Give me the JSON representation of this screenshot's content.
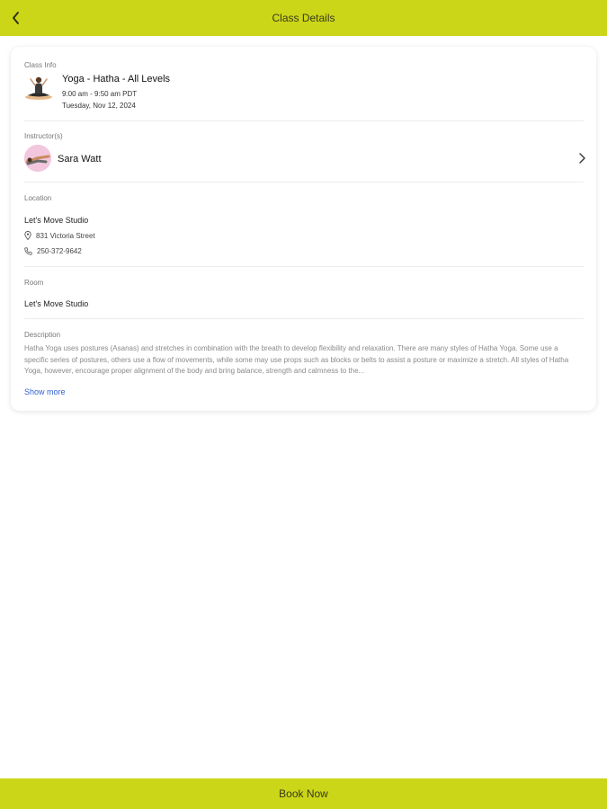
{
  "header": {
    "title": "Class Details",
    "back_icon": "chevron-left-icon"
  },
  "class_info": {
    "section_label": "Class Info",
    "name": "Yoga - Hatha - All Levels",
    "time": "9:00 am - 9:50 am PDT",
    "date": "Tuesday, Nov 12, 2024"
  },
  "instructor": {
    "section_label": "Instructor(s)",
    "name": "Sara Watt"
  },
  "location": {
    "section_label": "Location",
    "name": "Let's Move Studio",
    "address": "831 Victoria Street",
    "phone": "250-372-9642"
  },
  "room": {
    "section_label": "Room",
    "name": "Let's Move Studio"
  },
  "description": {
    "section_label": "Description",
    "text": "Hatha Yoga uses postures (Asanas) and stretches in combination with the breath to develop flexibility and relaxation. There are many styles of Hatha Yoga. Some use a specific series of postures, others use a flow of movements, while some may use props such as blocks or belts to assist a posture or maximize a stretch. All styles of Hatha Yoga, however, encourage proper alignment of the body and bring balance, strength and calmness to the...",
    "show_more": "Show more"
  },
  "footer": {
    "book_label": "Book Now"
  },
  "colors": {
    "accent": "#cbd618",
    "link": "#2f5fd0"
  }
}
